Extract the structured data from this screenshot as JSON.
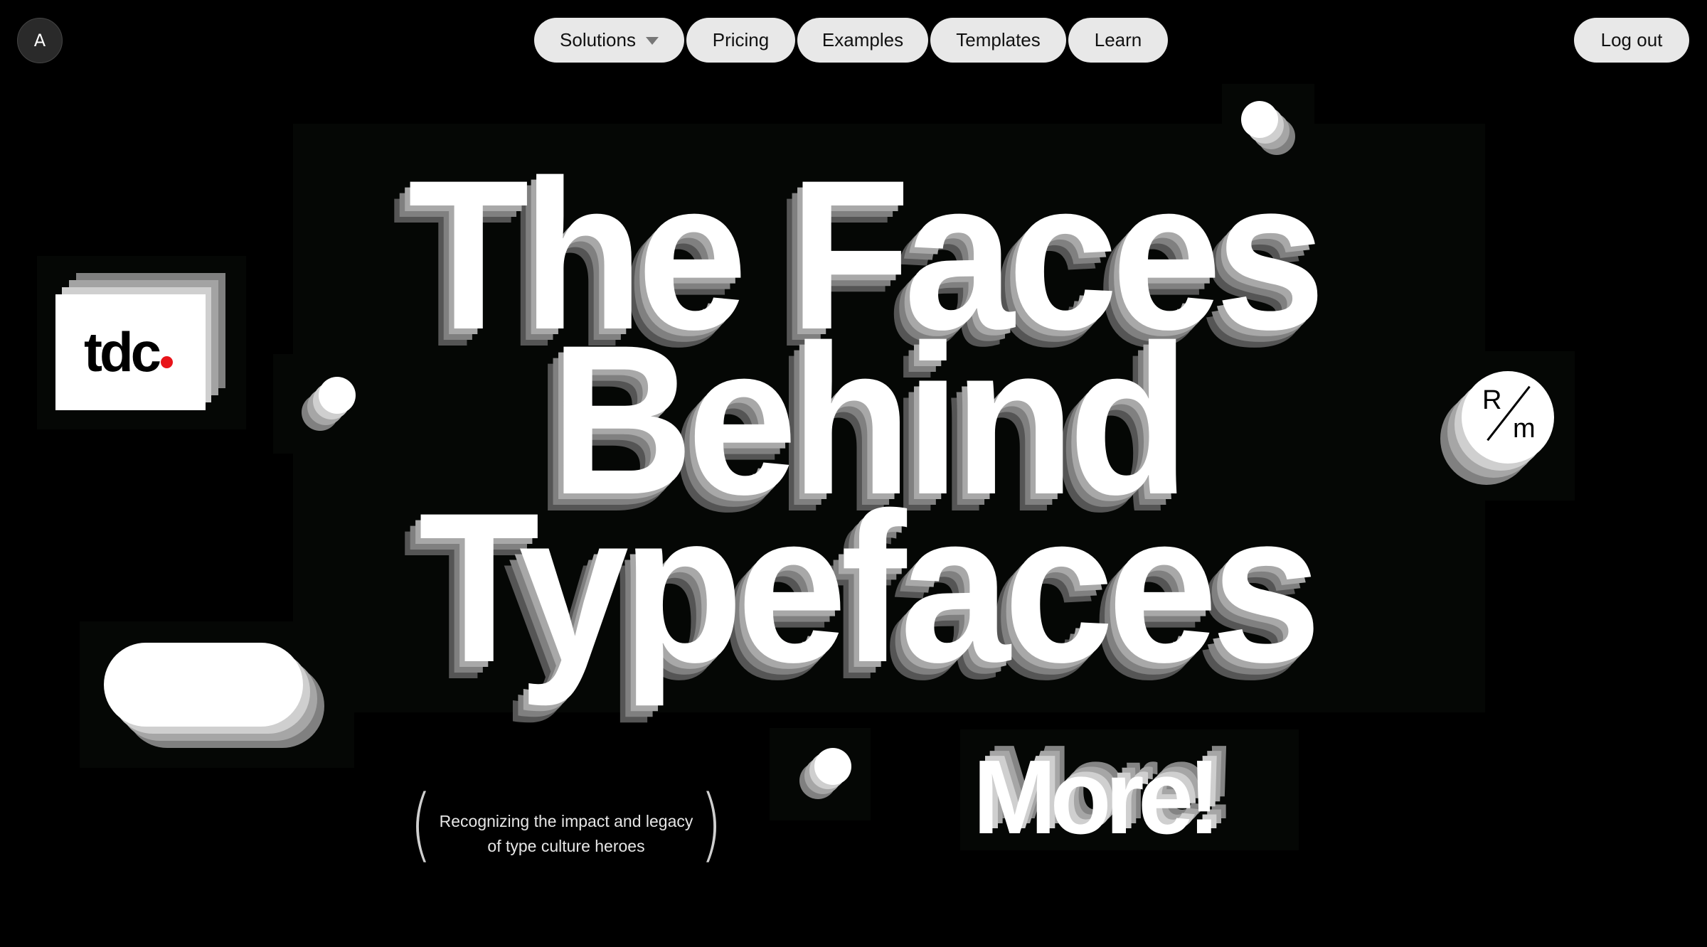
{
  "header": {
    "avatar_initial": "A",
    "nav": [
      {
        "label": "Solutions",
        "has_dropdown": true
      },
      {
        "label": "Pricing"
      },
      {
        "label": "Examples"
      },
      {
        "label": "Templates"
      },
      {
        "label": "Learn"
      }
    ],
    "logout_label": "Log out"
  },
  "hero": {
    "headline_lines": [
      "The Faces",
      "Behind",
      "Typefaces"
    ],
    "subtitle_line1": "Recognizing the impact and legacy",
    "subtitle_line2": "of type culture heroes",
    "paren_open": "(",
    "paren_close": ")",
    "more_label": "More!"
  },
  "logos": {
    "tdc_text": "tdc",
    "tdc_dot_color": "#e8141a",
    "rm_top": "R",
    "rm_bottom": "m"
  },
  "colors": {
    "background": "#000000",
    "pill_bg": "#e8e8e8",
    "extrude_1": "#cfcfcf",
    "extrude_2": "#a6a6a6",
    "extrude_3": "#808080"
  },
  "icons": {
    "dropdown": "caret-down-icon"
  }
}
